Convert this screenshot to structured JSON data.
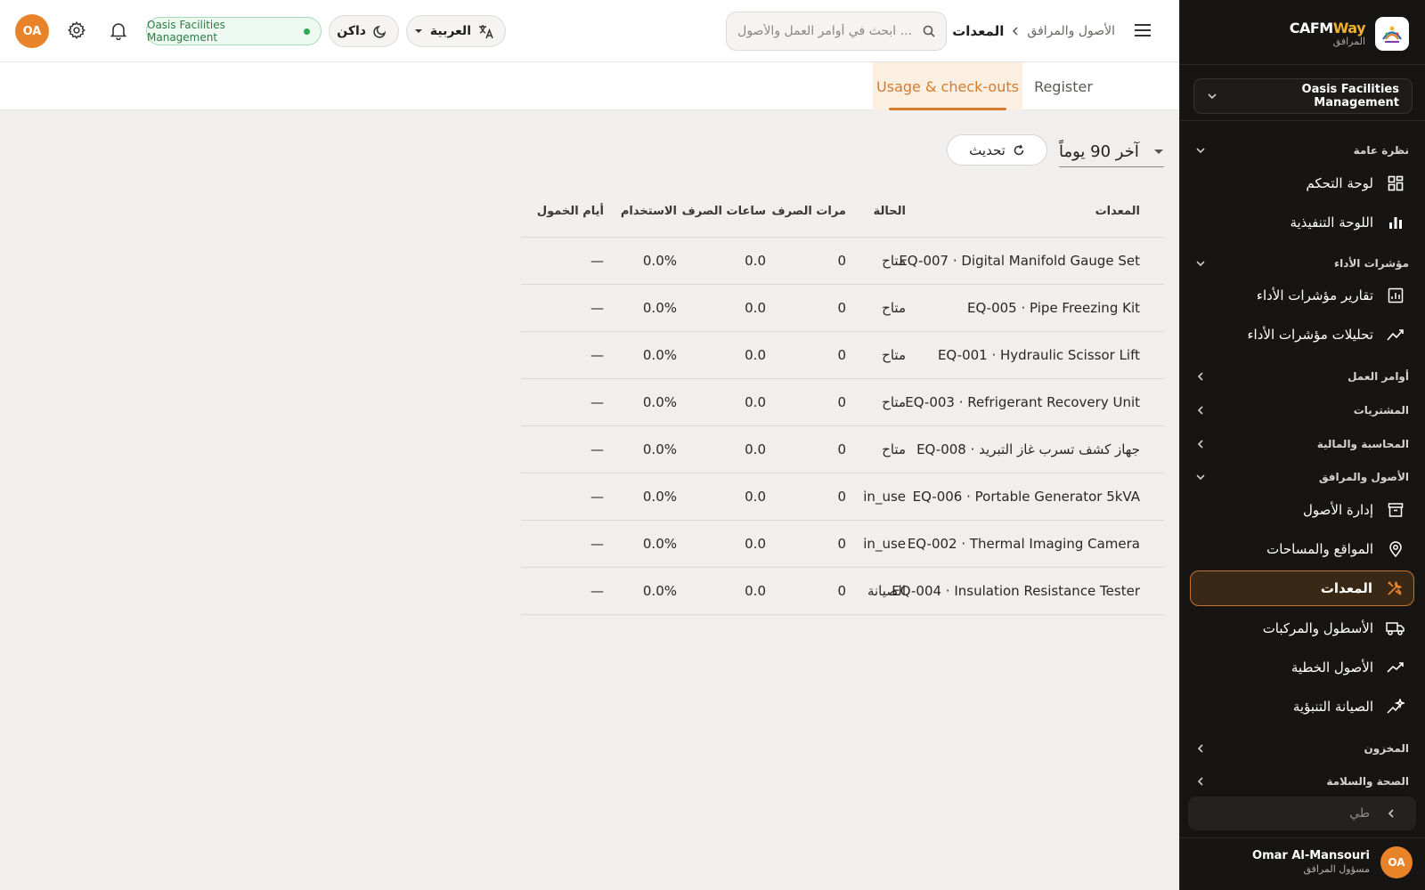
{
  "sidebar": {
    "brand": {
      "name_a": "CAFM",
      "name_b": "Way",
      "subtitle": "المرافق"
    },
    "org_select": "Oasis Facilities Management",
    "sections": [
      {
        "label": "نظرة عامة",
        "items": [
          {
            "label": "لوحة التحكم",
            "icon": "dashboard-icon"
          },
          {
            "label": "اللوحة التنفيذية",
            "icon": "bar-chart-icon"
          }
        ]
      },
      {
        "label": "مؤشرات الأداء",
        "items": [
          {
            "label": "تقارير مؤشرات الأداء",
            "icon": "report-chart-icon"
          },
          {
            "label": "تحليلات مؤشرات الأداء",
            "icon": "analytics-icon"
          }
        ]
      },
      {
        "label": "أوامر العمل"
      },
      {
        "label": "المشتريات"
      },
      {
        "label": "المحاسبة والمالية"
      },
      {
        "label": "الأصول والمرافق",
        "items": [
          {
            "label": "إدارة الأصول",
            "icon": "archive-icon"
          },
          {
            "label": "المواقع والمساحات",
            "icon": "location-pin-icon"
          },
          {
            "label": "المعدات",
            "icon": "tools-icon",
            "active": true
          },
          {
            "label": "الأسطول والمركبات",
            "icon": "truck-icon"
          },
          {
            "label": "الأصول الخطية",
            "icon": "trend-line-icon"
          },
          {
            "label": "الصيانة التنبؤية",
            "icon": "sparkle-trend-icon"
          }
        ]
      },
      {
        "label": "المخزون"
      },
      {
        "label": "الصحة والسلامة"
      }
    ],
    "collapse_label": "طي",
    "user": {
      "initials": "OA",
      "name": "Omar Al-Mansouri",
      "role": "مسؤول المرافق"
    }
  },
  "topbar": {
    "breadcrumb": {
      "parent": "الأصول والمرافق",
      "current": "المعدات"
    },
    "search_placeholder": "ابحث في أوامر العمل والأصول ...",
    "language": "العربية",
    "theme": "داكن",
    "org_badge": "Oasis Facilities Management",
    "avatar": "OA"
  },
  "tabs": {
    "register": "Register",
    "usage": "Usage & check-outs"
  },
  "controls": {
    "period": "آخر 90 يوماً",
    "refresh": "تحديث"
  },
  "table": {
    "columns": [
      "المعدات",
      "الحالة",
      "مرات الصرف",
      "ساعات الصرف",
      "الاستخدام",
      "أيام الخمول"
    ],
    "rows": [
      [
        "EQ-007 · Digital Manifold Gauge Set",
        "متاح",
        "0",
        "0.0",
        "0.0%",
        "—"
      ],
      [
        "EQ-005 · Pipe Freezing Kit",
        "متاح",
        "0",
        "0.0",
        "0.0%",
        "—"
      ],
      [
        "EQ-001 · Hydraulic Scissor Lift",
        "متاح",
        "0",
        "0.0",
        "0.0%",
        "—"
      ],
      [
        "EQ-003 · Refrigerant Recovery Unit",
        "متاح",
        "0",
        "0.0",
        "0.0%",
        "—"
      ],
      [
        "EQ-008 · جهاز كشف تسرب غاز التبريد",
        "متاح",
        "0",
        "0.0",
        "0.0%",
        "—"
      ],
      [
        "EQ-006 · Portable Generator 5kVA",
        "in_use",
        "0",
        "0.0",
        "0.0%",
        "—"
      ],
      [
        "EQ-002 · Thermal Imaging Camera",
        "in_use",
        "0",
        "0.0",
        "0.0%",
        "—"
      ],
      [
        "EQ-004 · Insulation Resistance Tester",
        "الصيانة",
        "0",
        "0.0",
        "0.0%",
        "—"
      ]
    ]
  },
  "colors": {
    "accent": "#d67a2c",
    "sidebar_bg": "#161514",
    "page_bg": "#f0efed",
    "ok": "#2eaa55"
  }
}
